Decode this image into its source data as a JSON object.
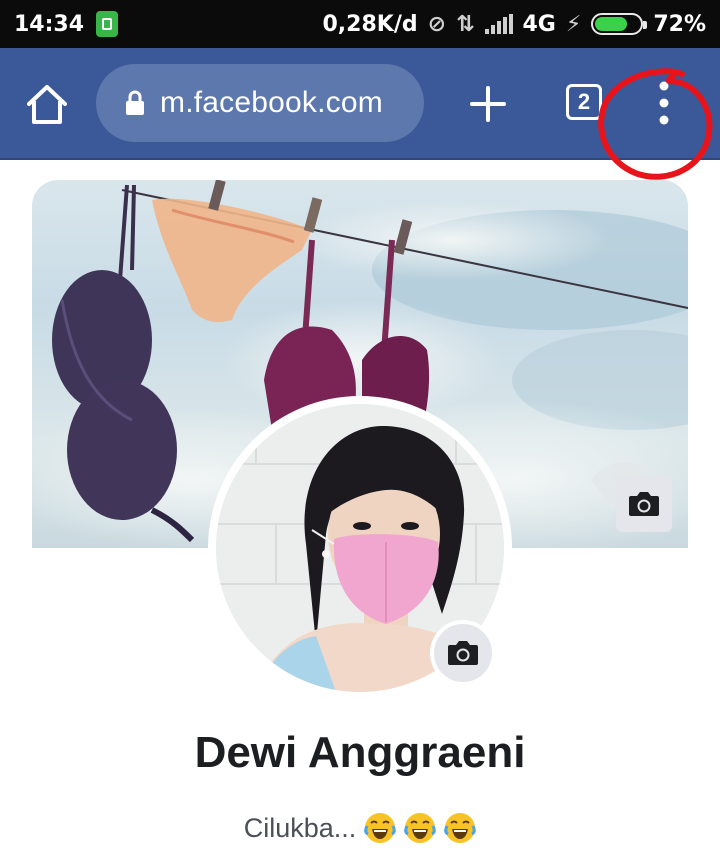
{
  "status_bar": {
    "time": "14:34",
    "speed": "0,28K/d",
    "network": "4G",
    "battery": "72%",
    "battery_level": 0.72
  },
  "browser": {
    "url": "m.facebook.com",
    "tab_count": "2",
    "icons": [
      "home-icon",
      "lock-icon",
      "plus-icon",
      "tabs-icon",
      "more-vert-icon"
    ]
  },
  "annotation": {
    "color": "#e8141b",
    "target": "more-vert-icon"
  },
  "profile": {
    "name": "Dewi Anggraeni",
    "bio": "Cilukba...",
    "bio_emoji": [
      "face-with-tears-of-joy",
      "face-with-tears-of-joy",
      "face-with-tears-of-joy"
    ]
  },
  "colors": {
    "toolbar": "#3b5998",
    "url_bar": "#5c78ad",
    "camera_button": "#e4e6eb"
  }
}
